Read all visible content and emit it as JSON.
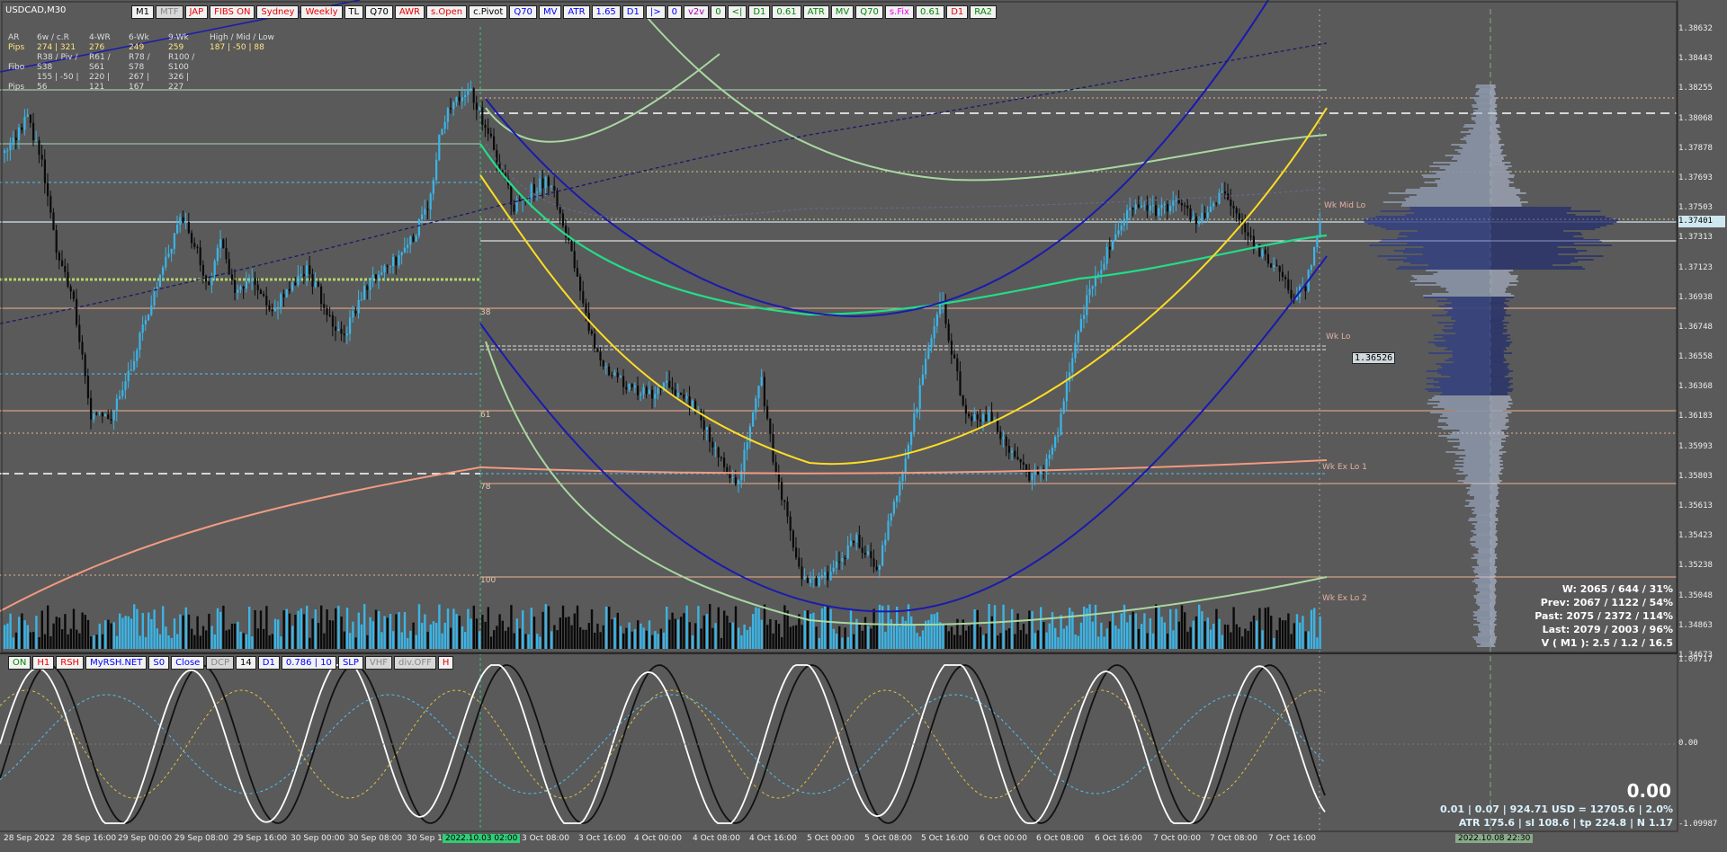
{
  "window_title": "USDCAD,M30",
  "top_toolbar": [
    {
      "label": "M1",
      "bg": "#f2f2f2",
      "fg": "#000"
    },
    {
      "label": "MTF",
      "bg": "#d8d8d8",
      "fg": "#888"
    },
    {
      "label": "JAP",
      "bg": "#f2f2f2",
      "fg": "#e00"
    },
    {
      "label": "FIBS ON",
      "bg": "#f2f2f2",
      "fg": "#e00"
    },
    {
      "label": "Sydney",
      "bg": "#f2f2f2",
      "fg": "#e00"
    },
    {
      "label": "Weekly",
      "bg": "#f2f2f2",
      "fg": "#e00"
    },
    {
      "label": "TL",
      "bg": "#f2f2f2",
      "fg": "#000"
    },
    {
      "label": "Q70",
      "bg": "#f2f2f2",
      "fg": "#000"
    },
    {
      "label": "AWR",
      "bg": "#f2f2f2",
      "fg": "#e00"
    },
    {
      "label": "s.Open",
      "bg": "#f2f2f2",
      "fg": "#e00"
    },
    {
      "label": "c.Pivot",
      "bg": "#f2f2f2",
      "fg": "#000"
    },
    {
      "label": "Q70",
      "bg": "#f2f2f2",
      "fg": "#00f"
    },
    {
      "label": "MV",
      "bg": "#f2f2f2",
      "fg": "#00f"
    },
    {
      "label": "ATR",
      "bg": "#f2f2f2",
      "fg": "#00f"
    },
    {
      "label": "1.65",
      "bg": "#f2f2f2",
      "fg": "#00f"
    },
    {
      "label": "D1",
      "bg": "#f2f2f2",
      "fg": "#00f"
    },
    {
      "label": "|>",
      "bg": "#f2f2f2",
      "fg": "#00f"
    },
    {
      "label": "0",
      "bg": "#f2f2f2",
      "fg": "#00f"
    },
    {
      "label": "v2v",
      "bg": "#f2f2f2",
      "fg": "#a0a"
    },
    {
      "label": "0",
      "bg": "#f2f2f2",
      "fg": "#080"
    },
    {
      "label": "<|",
      "bg": "#f2f2f2",
      "fg": "#080"
    },
    {
      "label": "D1",
      "bg": "#f2f2f2",
      "fg": "#080"
    },
    {
      "label": "0.61",
      "bg": "#f2f2f2",
      "fg": "#080"
    },
    {
      "label": "ATR",
      "bg": "#f2f2f2",
      "fg": "#080"
    },
    {
      "label": "MV",
      "bg": "#f2f2f2",
      "fg": "#080"
    },
    {
      "label": "Q70",
      "bg": "#f2f2f2",
      "fg": "#080"
    },
    {
      "label": "s.Fix",
      "bg": "#f2f2f2",
      "fg": "#e0e"
    },
    {
      "label": "0.61",
      "bg": "#f2f2f2",
      "fg": "#080"
    },
    {
      "label": "D1",
      "bg": "#f2f2f2",
      "fg": "#e00"
    },
    {
      "label": "RA2",
      "bg": "#f2f2f2",
      "fg": "#080"
    }
  ],
  "info_panel": {
    "row1": [
      "AR",
      "6w / c.R",
      "4-WR",
      "6-Wk",
      "9-Wk",
      "High / Mid / Low"
    ],
    "row2": [
      "Pips",
      "274 | 321",
      "276",
      "249",
      "259",
      "187 | -50 | 88"
    ],
    "row3": [
      "Fibo",
      "R38 / Piv / S38",
      "R61 / S61",
      "R78 / S78",
      "R100 / S100"
    ],
    "row4": [
      "Pips",
      "155 | -50 | 56",
      "220 | 121",
      "267 | 167",
      "326 | 227"
    ]
  },
  "fib_labels": [
    "38",
    "61",
    "78",
    "100"
  ],
  "level_tags": [
    "Wk Mid Lo",
    "Wk Lo",
    "Wk Ex Lo 1",
    "Wk Ex Lo 2"
  ],
  "marker_price": "1.36526",
  "current_price": "1.37401",
  "price_axis": [
    "1.38632",
    "1.38443",
    "1.38255",
    "1.38068",
    "1.37878",
    "1.37693",
    "1.37503",
    "1.37313",
    "1.37123",
    "1.36938",
    "1.36748",
    "1.36558",
    "1.36368",
    "1.36183",
    "1.35993",
    "1.35803",
    "1.35613",
    "1.35423",
    "1.35238",
    "1.35048",
    "1.34863",
    "1.34673"
  ],
  "osc_axis": [
    "1.09717",
    "0.00",
    "-1.09987"
  ],
  "time_axis": [
    "28 Sep 2022",
    "28 Sep 16:00",
    "29 Sep 00:00",
    "29 Sep 08:00",
    "29 Sep 16:00",
    "30 Sep 00:00",
    "30 Sep 08:00",
    "30 Sep 16:00",
    "2022.10.03 02:00",
    "3 Oct 08:00",
    "3 Oct 16:00",
    "4 Oct 00:00",
    "4 Oct 08:00",
    "4 Oct 16:00",
    "5 Oct 00:00",
    "5 Oct 08:00",
    "5 Oct 16:00",
    "6 Oct 00:00",
    "6 Oct 08:00",
    "6 Oct 16:00",
    "7 Oct 00:00",
    "7 Oct 08:00",
    "7 Oct 16:00",
    "2022.10.08 22:30"
  ],
  "stats": [
    "W: 2065 / 644 / 31%",
    "Prev: 2067 / 1122 / 54%",
    "Past: 2075 / 2372 / 114%",
    "Last: 2079 / 2003 / 96%",
    "V ( M1 ): 2.5 / 1.2 / 16.5"
  ],
  "osc_toolbar": [
    {
      "label": "ON",
      "bg": "#f2f2f2",
      "fg": "#080"
    },
    {
      "label": "H1",
      "bg": "#f2f2f2",
      "fg": "#e00"
    },
    {
      "label": "RSH",
      "bg": "#f2f2f2",
      "fg": "#e00"
    },
    {
      "label": "MyRSH.NET",
      "bg": "#f2f2f2",
      "fg": "#00f"
    },
    {
      "label": "S0",
      "bg": "#f2f2f2",
      "fg": "#00f"
    },
    {
      "label": "Close",
      "bg": "#f2f2f2",
      "fg": "#00f"
    },
    {
      "label": "DCP",
      "bg": "#d8d8d8",
      "fg": "#888"
    },
    {
      "label": "14",
      "bg": "#f2f2f2",
      "fg": "#000"
    },
    {
      "label": "D1",
      "bg": "#f2f2f2",
      "fg": "#00f"
    },
    {
      "label": "0.786 | 10",
      "bg": "#f2f2f2",
      "fg": "#00f"
    },
    {
      "label": "SLP",
      "bg": "#f2f2f2",
      "fg": "#00f"
    },
    {
      "label": "VHF",
      "bg": "#d8d8d8",
      "fg": "#888"
    },
    {
      "label": "div.OFF",
      "bg": "#d8d8d8",
      "fg": "#888"
    },
    {
      "label": "H",
      "bg": "#f2f2f2",
      "fg": "#e00"
    }
  ],
  "osc_value": "0.00",
  "bottom_stats": [
    "0.01  |  0.07  |  924.71 USD = 12705.6  |  2.0%",
    "ATR 175.6  |  sl 108.6  |  tp 224.8  |  N 1.17"
  ],
  "colors": {
    "background": "#5a5a5a",
    "bull": "#3bb4e6",
    "bear": "#0a0a0a",
    "ma_green": "#22dd88",
    "ma_light": "#a8d8a0",
    "curve_blue": "#1a1ab0",
    "curve_yellow": "#ffdd22",
    "ma_salmon": "#f29a80",
    "current_price": "#cfe8f0"
  }
}
